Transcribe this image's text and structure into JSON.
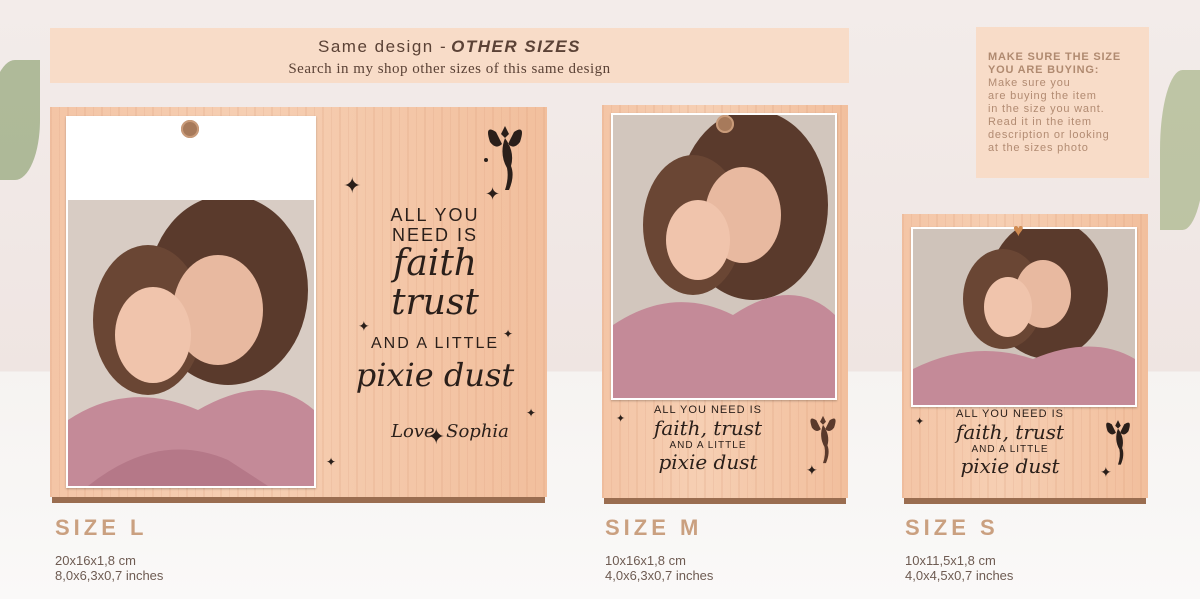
{
  "banner": {
    "title_main": "Same design -",
    "title_em": "OTHER SIZES",
    "subtitle": "Search in my shop other sizes of this same design"
  },
  "note": {
    "heading_1": "MAKE SURE THE SIZE",
    "heading_2": "YOU ARE BUYING:",
    "body_1": "Make sure you",
    "body_2": "are buying the item",
    "body_3": "in the size you want.",
    "body_4": "Read it in the item",
    "body_5": "description or looking",
    "body_6": "at the sizes photo"
  },
  "quote": {
    "line1": "ALL YOU",
    "line2": "NEED IS",
    "faith": "faith",
    "trust": "trust",
    "line3": "AND A LITTLE",
    "pixie": "pixie dust",
    "signature": "Love, Sophia",
    "small_line1": "ALL YOU NEED IS",
    "small_faith_trust": "faith, trust",
    "small_line3": "AND A LITTLE",
    "small_pixie": "pixie dust"
  },
  "sizes": [
    {
      "label": "SIZE L",
      "cm": "20x16x1,8 cm",
      "inches": "8,0x6,3x0,7 inches"
    },
    {
      "label": "SIZE M",
      "cm": "10x16x1,8 cm",
      "inches": "4,0x6,3x0,7 inches"
    },
    {
      "label": "SIZE S",
      "cm": "10x11,5x1,8 cm",
      "inches": "4,0x4,5x0,7 inches"
    }
  ],
  "icons": {
    "fairy": "fairy-icon",
    "star": "sparkle-star-icon",
    "pin": "wood-pin-icon",
    "heart": "heart-pin-icon"
  },
  "colors": {
    "banner": "#f8dcc8",
    "wood": "#f4c5a6",
    "label": "#caa080",
    "text": "#2a1f1a"
  }
}
